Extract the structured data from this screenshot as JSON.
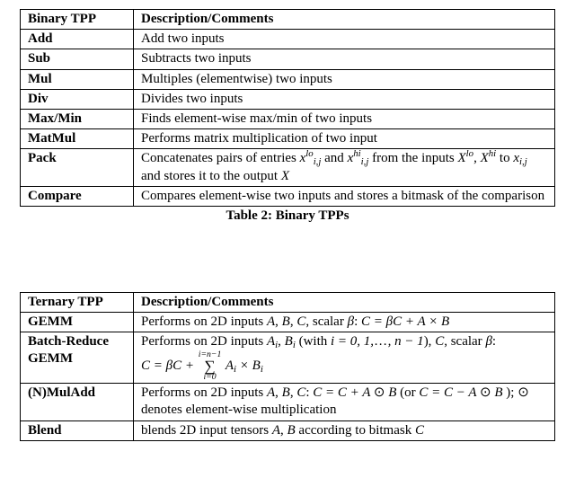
{
  "chart_data": [
    {
      "type": "table",
      "title": "Table 2: Binary TPPs",
      "columns": [
        "Binary TPP",
        "Description/Comments"
      ],
      "rows": [
        [
          "Add",
          "Add two inputs"
        ],
        [
          "Sub",
          "Subtracts two inputs"
        ],
        [
          "Mul",
          "Multiples (elementwise) two inputs"
        ],
        [
          "Div",
          "Divides two inputs"
        ],
        [
          "Max/Min",
          "Finds element-wise max/min of two inputs"
        ],
        [
          "MatMul",
          "Performs matrix multiplication of two input"
        ],
        [
          "Pack",
          "Concatenates pairs of entries x_{i,j}^{lo} and x_{i,j}^{hi} from the inputs X^{lo}, X^{hi} to x_{i,j} and stores it to the output X"
        ],
        [
          "Compare",
          "Compares element-wise two inputs and stores a bitmask of the comparison"
        ]
      ]
    },
    {
      "type": "table",
      "title": "Ternary TPPs",
      "columns": [
        "Ternary TPP",
        "Description/Comments"
      ],
      "rows": [
        [
          "GEMM",
          "Performs on 2D inputs A, B, C, scalar β: C = βC + A × B"
        ],
        [
          "Batch-Reduce GEMM",
          "Performs on 2D inputs A_i, B_i (with i = 0, 1, …, n − 1), C, scalar β: C = βC + Σ_{i=0}^{i=n-1} A_i × B_i"
        ],
        [
          "(N)MulAdd",
          "Performs on 2D inputs A, B, C: C = C + A ⊙ B (or C = C − A ⊙ B ); ⊙ denotes element-wise multiplication"
        ],
        [
          "Blend",
          "blends 2D input tensors A, B according to bitmask C"
        ]
      ]
    }
  ],
  "table2": {
    "header": {
      "c1": "Binary TPP",
      "c2": "Description/Comments"
    },
    "rows": {
      "add": {
        "name": "Add",
        "desc": "Add two inputs"
      },
      "sub": {
        "name": "Sub",
        "desc": "Subtracts two inputs"
      },
      "mul": {
        "name": "Mul",
        "desc": "Multiples (elementwise) two inputs"
      },
      "div": {
        "name": "Div",
        "desc": "Divides two inputs"
      },
      "maxmin": {
        "name": "Max/Min",
        "desc": "Finds element-wise max/min of two inputs"
      },
      "matmul": {
        "name": "MatMul",
        "desc": "Performs matrix multiplication of two input"
      },
      "pack": {
        "name": "Pack",
        "desc_a": "Concatenates pairs of entries ",
        "desc_b": " and ",
        "desc_c": " from the inputs ",
        "desc_d": " to ",
        "desc_e": " and stores it to the output ",
        "sym_x": "x",
        "sym_X": "X",
        "sub_ij": "i,j",
        "sup_lo": "lo",
        "sup_hi": "hi",
        "comma": ", "
      },
      "compare": {
        "name": "Compare",
        "desc": "Compares element-wise two inputs and stores a bitmask of the comparison"
      }
    },
    "caption": "Table 2: Binary TPPs"
  },
  "table3": {
    "header": {
      "c1": "Ternary TPP",
      "c2": "Description/Comments"
    },
    "rows": {
      "gemm": {
        "name": "GEMM",
        "pre": "Performs on 2D inputs ",
        "A": "A",
        "B": "B",
        "C": "C",
        "scalar": ", scalar ",
        "beta": "β",
        "colon": ": ",
        "eq": "C = βC + A × B",
        "comma": ", "
      },
      "brgemm": {
        "name": "Batch-Reduce GEMM",
        "pre": "Performs on 2D inputs ",
        "A": "A",
        "B": "B",
        "C": "C",
        "sub_i": "i",
        "with_open": " (with ",
        "range": "i = 0, 1,",
        "ellipsis": "…",
        "range2": ", n − 1",
        "with_close": "), ",
        "scalar": "scalar ",
        "beta": "β",
        "colon": ": ",
        "lhs": "C = βC + ",
        "sum_top": "i=n−1",
        "sum_bot": "i=0",
        "rhs": " A",
        "times": " × B",
        "comma": ", "
      },
      "nmuladd": {
        "name": "(N)MulAdd",
        "pre": "Performs on 2D inputs ",
        "A": "A",
        "B": "B",
        "C": "C",
        "colon": ": ",
        "eq1": "C = C + A ",
        "odot": "⊙",
        "eq1b": " B",
        "or_open": " (or ",
        "eq2": "C = C − A ",
        "eq2b": " B ",
        "or_close": "); ",
        "tail": " denotes element-wise multiplication",
        "comma": ", "
      },
      "blend": {
        "name": "Blend",
        "pre": "blends 2D input tensors ",
        "A": "A",
        "B": "B",
        "mid": " according to bitmask ",
        "C": "C",
        "comma": ", "
      }
    }
  }
}
